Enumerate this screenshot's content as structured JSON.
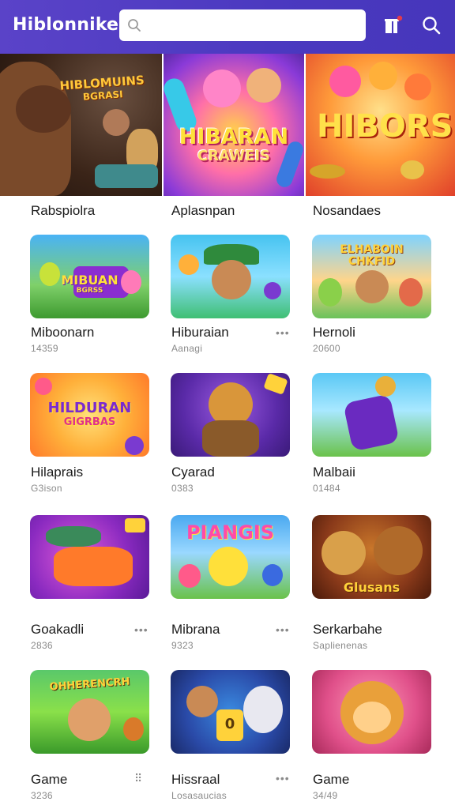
{
  "header": {
    "brand": "Hiblonnike",
    "search_placeholder": "",
    "icons": [
      "search-icon",
      "ranking-icon",
      "search-icon"
    ],
    "colors": {
      "bar": "#4b39c0",
      "search_bg": "#ffffff"
    }
  },
  "hero": [
    {
      "art_text_1": "HIBLOMUINS",
      "art_text_2": "BGRASI",
      "caption": "Rabspiolra"
    },
    {
      "art_text_1": "HIBARAN",
      "art_text_2": "CRAWEIS",
      "caption": "Aplasnpan"
    },
    {
      "art_text_1": "HIBORS",
      "caption": "Nosandaes"
    }
  ],
  "grid": [
    {
      "title": "Miboonarn",
      "sub": "14359",
      "art_text": "MIBUAN",
      "art_text_2": "BGRSS"
    },
    {
      "title": "Hiburaian",
      "sub": "Aanagi",
      "more": "•••"
    },
    {
      "title": "Hernoli",
      "sub": "20600",
      "art_text": "ELHABOIN",
      "art_text_2": "CHKFID"
    },
    {
      "title": "Hilaprais",
      "sub": "G3ison",
      "art_text": "HILDURAN",
      "art_text_2": "GIGRBAS"
    },
    {
      "title": "Cyarad",
      "sub": "0383"
    },
    {
      "title": "Malbaii",
      "sub": "01484"
    },
    {
      "title": "Goakadli",
      "sub": "2836",
      "more": "•••"
    },
    {
      "title": "Mibrana",
      "sub": "9323",
      "more": "•••",
      "art_text": "PIANGIS"
    },
    {
      "title": "Serkarbahe",
      "sub": "Saplienenas",
      "art_text": "Glusans"
    },
    {
      "title": "Game",
      "sub": "3236",
      "more": "⠿",
      "art_text": "OHHERENCRH"
    },
    {
      "title": "Hissraal",
      "sub": "Losasaucias",
      "more": "•••",
      "art_text": "0"
    },
    {
      "title": "Game",
      "sub": "34/49"
    }
  ]
}
